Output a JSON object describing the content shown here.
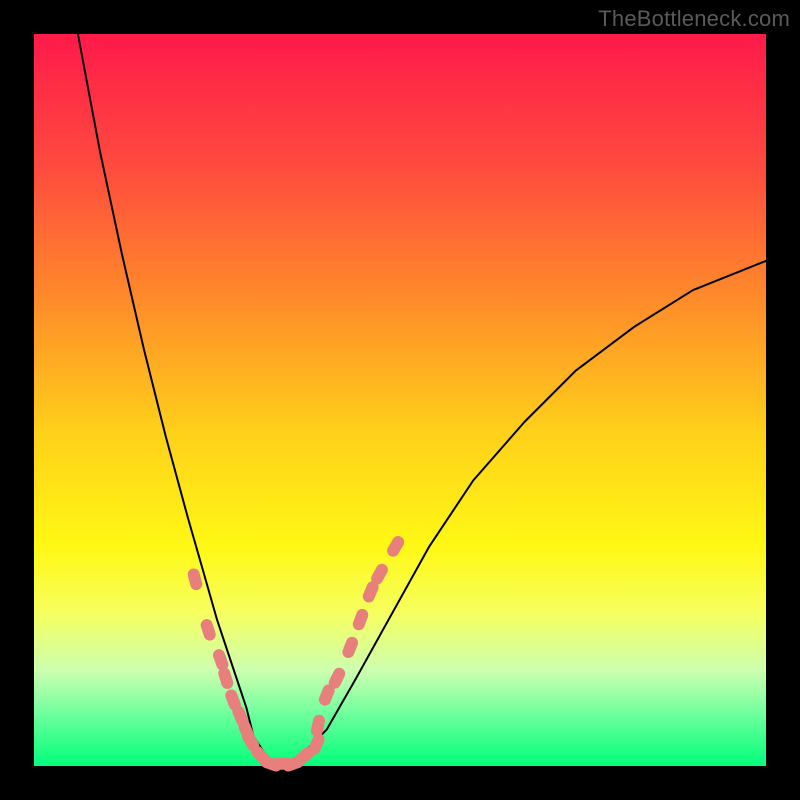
{
  "watermark": "TheBottleneck.com",
  "chart_data": {
    "type": "line",
    "title": "",
    "xlabel": "",
    "ylabel": "",
    "xlim": [
      0,
      1
    ],
    "ylim": [
      0,
      1
    ],
    "grid": false,
    "legend": false,
    "background_gradient": {
      "orientation": "vertical",
      "stops": [
        {
          "pos": 0.0,
          "color": "#ff1a4a"
        },
        {
          "pos": 0.18,
          "color": "#ff4a3e"
        },
        {
          "pos": 0.36,
          "color": "#ff8a2a"
        },
        {
          "pos": 0.54,
          "color": "#ffcf1a"
        },
        {
          "pos": 0.7,
          "color": "#fff814"
        },
        {
          "pos": 0.79,
          "color": "#f6ff5e"
        },
        {
          "pos": 0.87,
          "color": "#ccffaf"
        },
        {
          "pos": 0.93,
          "color": "#6dff9c"
        },
        {
          "pos": 1.0,
          "color": "#00ff7a"
        }
      ]
    },
    "series": [
      {
        "name": "bottleneck-curve",
        "color": "#000000",
        "x": [
          0.06,
          0.09,
          0.12,
          0.15,
          0.18,
          0.21,
          0.23,
          0.25,
          0.27,
          0.29,
          0.3,
          0.32,
          0.34,
          0.36,
          0.4,
          0.44,
          0.49,
          0.54,
          0.6,
          0.67,
          0.74,
          0.82,
          0.9,
          1.0
        ],
        "y": [
          1.0,
          0.84,
          0.7,
          0.57,
          0.45,
          0.34,
          0.27,
          0.2,
          0.14,
          0.08,
          0.04,
          0.01,
          0.005,
          0.01,
          0.05,
          0.12,
          0.21,
          0.3,
          0.39,
          0.47,
          0.54,
          0.6,
          0.65,
          0.69
        ]
      }
    ],
    "markers": {
      "name": "highlighted-points",
      "color": "#e77f7d",
      "shape": "capsule",
      "points": [
        {
          "x": 0.22,
          "y": 0.255
        },
        {
          "x": 0.238,
          "y": 0.186
        },
        {
          "x": 0.255,
          "y": 0.145
        },
        {
          "x": 0.262,
          "y": 0.12
        },
        {
          "x": 0.272,
          "y": 0.09
        },
        {
          "x": 0.282,
          "y": 0.068
        },
        {
          "x": 0.29,
          "y": 0.048
        },
        {
          "x": 0.296,
          "y": 0.034
        },
        {
          "x": 0.31,
          "y": 0.014
        },
        {
          "x": 0.324,
          "y": 0.003
        },
        {
          "x": 0.34,
          "y": 0.003
        },
        {
          "x": 0.354,
          "y": 0.003
        },
        {
          "x": 0.37,
          "y": 0.014
        },
        {
          "x": 0.386,
          "y": 0.03
        },
        {
          "x": 0.388,
          "y": 0.055
        },
        {
          "x": 0.4,
          "y": 0.097
        },
        {
          "x": 0.414,
          "y": 0.12
        },
        {
          "x": 0.432,
          "y": 0.162
        },
        {
          "x": 0.446,
          "y": 0.2
        },
        {
          "x": 0.46,
          "y": 0.238
        },
        {
          "x": 0.472,
          "y": 0.262
        },
        {
          "x": 0.494,
          "y": 0.3
        }
      ]
    }
  }
}
